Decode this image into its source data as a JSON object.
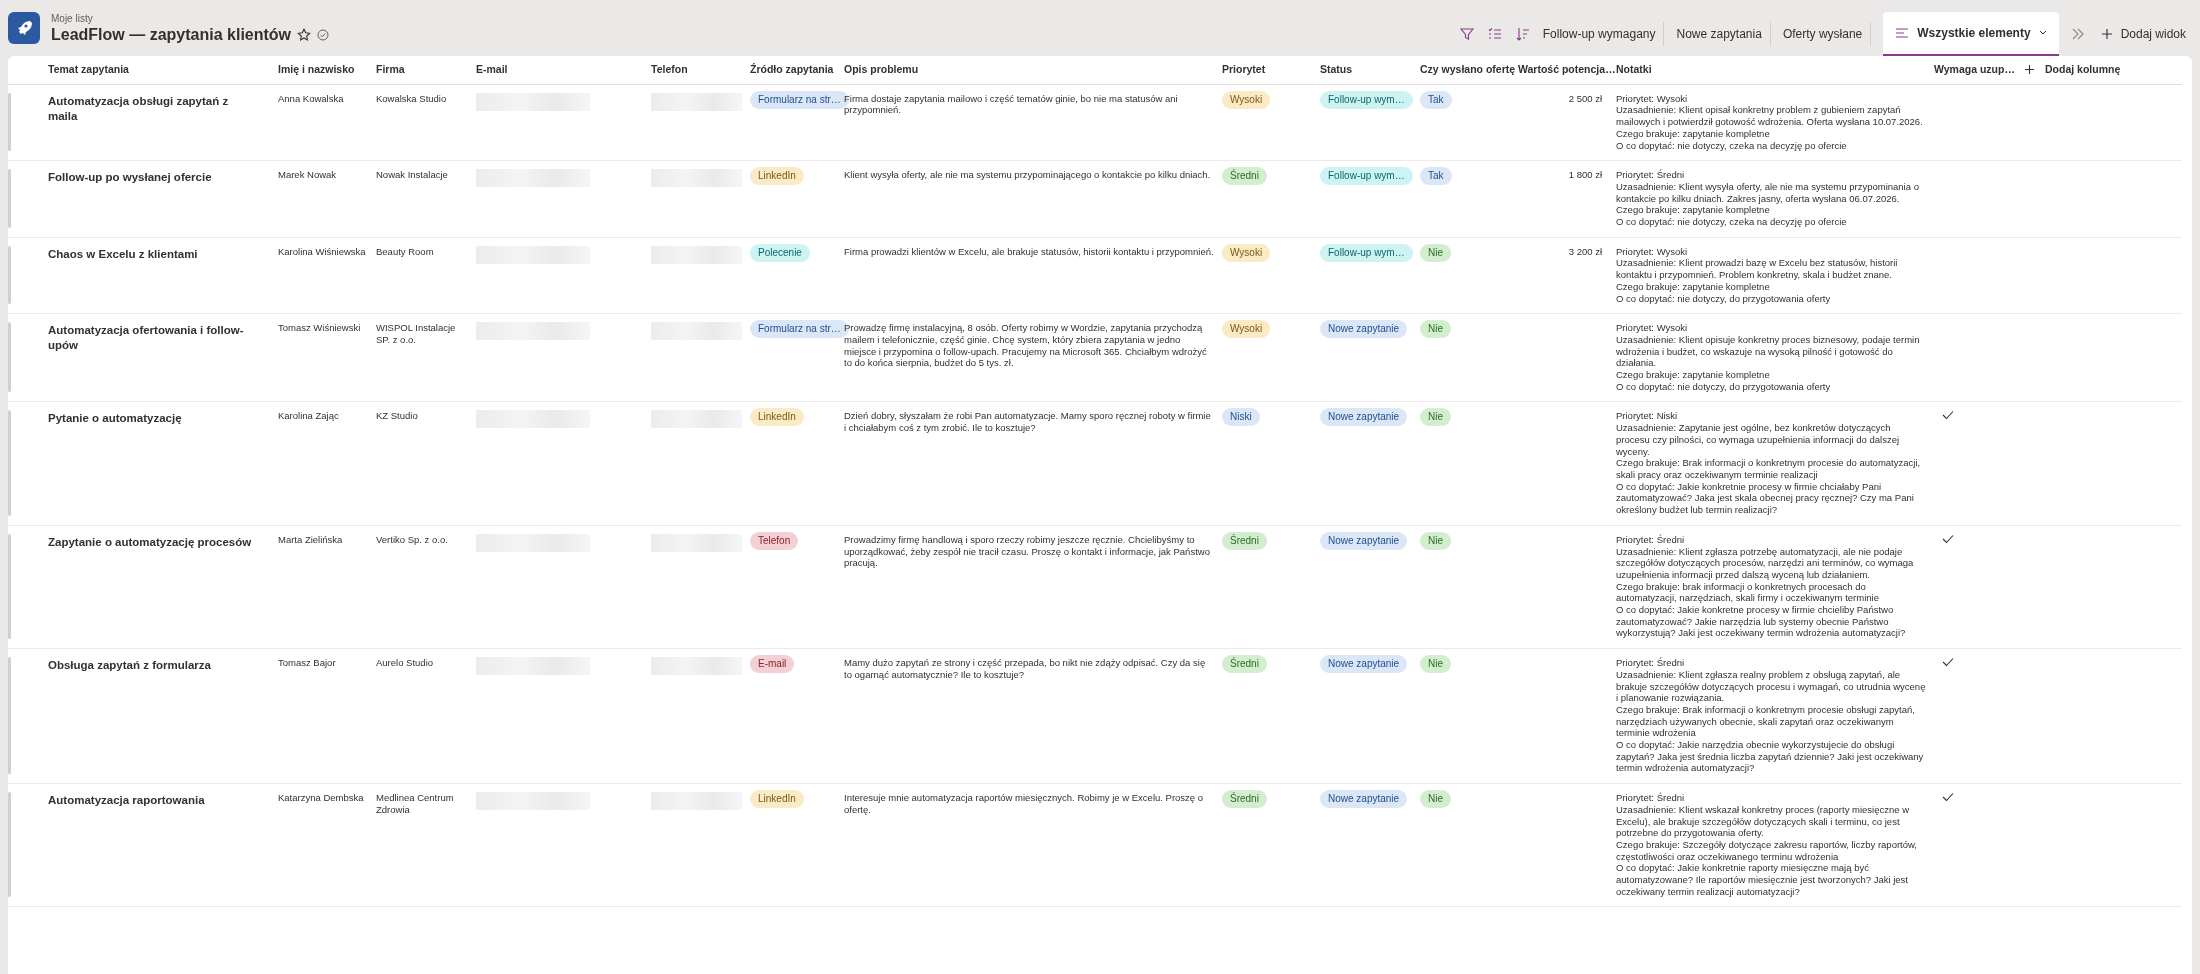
{
  "header": {
    "breadcrumb": "Moje listy",
    "title": "LeadFlow — zapytania klientów",
    "favorite": false
  },
  "views": [
    {
      "label": "Follow-up wymagany",
      "selected": false
    },
    {
      "label": "Nowe zapytania",
      "selected": false
    },
    {
      "label": "Oferty wysłane",
      "selected": false
    },
    {
      "label": "Wszystkie elementy",
      "selected": true
    }
  ],
  "add_view": "Dodaj widok",
  "columns": [
    "Temat zapytania",
    "Imię i nazwisko",
    "Firma",
    "E-mail",
    "Telefon",
    "Źródło zapytania",
    "Opis problemu",
    "Priorytet",
    "Status",
    "Czy wysłano ofertę",
    "Wartość potencja…",
    "Notatki",
    "Wymaga uzup…"
  ],
  "add_column": "Dodaj kolumnę",
  "rows": [
    {
      "subject": "Automatyzacja obsługi zapytań z maila",
      "name": "Anna Kowalska",
      "company": "Kowalska Studio",
      "source": {
        "label": "Formularz na str…",
        "color": "#dbe7f6"
      },
      "description": "Firma dostaje zapytania mailowo i część tematów ginie, bo nie ma statusów ani przypomnień.",
      "priority": {
        "label": "Wysoki",
        "color": "#fbeac6"
      },
      "status": {
        "label": "Follow-up wym…",
        "color": "#cdf3f3"
      },
      "offer_sent": {
        "label": "Tak",
        "color": "#dbe7f6"
      },
      "value": "2 500 zł",
      "notes": [
        "Priorytet: Wysoki",
        "Uzasadnienie: Klient opisał konkretny problem z gubieniem zapytań mailowych i potwierdził gotowość wdrożenia. Oferta wysłana 10.07.2026.",
        "Czego brakuje: zapytanie kompletne",
        "O co dopytać: nie dotyczy, czeka na decyzję po ofercie"
      ],
      "needs_completion": false
    },
    {
      "subject": "Follow-up po wysłanej ofercie",
      "name": "Marek Nowak",
      "company": "Nowak Instalacje",
      "source": {
        "label": "LinkedIn",
        "color": "#fbeac6"
      },
      "description": "Klient wysyła oferty, ale nie ma systemu przypominającego o kontakcie po kilku dniach.",
      "priority": {
        "label": "Średni",
        "color": "#d3eecf"
      },
      "status": {
        "label": "Follow-up wym…",
        "color": "#cdf3f3"
      },
      "offer_sent": {
        "label": "Tak",
        "color": "#dbe7f6"
      },
      "value": "1 800 zł",
      "notes": [
        "Priorytet: Średni",
        "Uzasadnienie: Klient wysyła oferty, ale nie ma systemu przypominania o kontakcie po kilku dniach. Zakres jasny, oferta wysłana 06.07.2026.",
        "Czego brakuje: zapytanie kompletne",
        "O co dopytać: nie dotyczy, czeka na decyzję po ofercie"
      ],
      "needs_completion": false
    },
    {
      "subject": "Chaos w Excelu z klientami",
      "name": "Karolina Wiśniewska",
      "company": "Beauty Room",
      "source": {
        "label": "Polecenie",
        "color": "#cdf3f3"
      },
      "description": "Firma prowadzi klientów w Excelu, ale brakuje statusów, historii kontaktu i przypomnień.",
      "priority": {
        "label": "Wysoki",
        "color": "#fbeac6"
      },
      "status": {
        "label": "Follow-up wym…",
        "color": "#cdf3f3"
      },
      "offer_sent": {
        "label": "Nie",
        "color": "#d3eecf"
      },
      "value": "3 200 zł",
      "notes": [
        "Priorytet: Wysoki",
        "Uzasadnienie: Klient prowadzi bazę w Excelu bez statusów, historii kontaktu i przypomnień. Problem konkretny, skala i budżet znane.",
        "Czego brakuje: zapytanie kompletne",
        "O co dopytać: nie dotyczy, do przygotowania oferty"
      ],
      "needs_completion": false
    },
    {
      "subject": "Automatyzacja ofertowania i follow-upów",
      "name": "Tomasz Wiśniewski",
      "company": "WISPOL Instalacje SP. z o.o.",
      "source": {
        "label": "Formularz na str…",
        "color": "#dbe7f6"
      },
      "description": "Prowadzę firmę instalacyjną, 8 osób. Oferty robimy w Wordzie, zapytania przychodzą mailem i telefonicznie, część ginie. Chcę system, który zbiera zapytania w jedno miejsce i przypomina o follow-upach. Pracujemy na Microsoft 365. Chciałbym wdrożyć to do końca sierpnia, budżet do 5 tys. zł.",
      "priority": {
        "label": "Wysoki",
        "color": "#fbeac6"
      },
      "status": {
        "label": "Nowe zapytanie",
        "color": "#dbe7f6"
      },
      "offer_sent": {
        "label": "Nie",
        "color": "#d3eecf"
      },
      "notes": [
        "Priorytet: Wysoki",
        "Uzasadnienie: Klient opisuje konkretny proces biznesowy, podaje termin wdrożenia i budżet, co wskazuje na wysoką pilność i gotowość do działania.",
        "Czego brakuje: zapytanie kompletne",
        "O co dopytać: nie dotyczy, do przygotowania oferty"
      ],
      "needs_completion": false
    },
    {
      "subject": "Pytanie o automatyzację",
      "name": "Karolina Zając",
      "company": "KZ Studio",
      "source": {
        "label": "LinkedIn",
        "color": "#fbeac6"
      },
      "description": "Dzień dobry, słyszałam że robi Pan automatyzacje. Mamy sporo ręcznej roboty w firmie i chciałabym coś z tym zrobić. Ile to kosztuje?",
      "priority": {
        "label": "Niski",
        "color": "#dbe7f6"
      },
      "status": {
        "label": "Nowe zapytanie",
        "color": "#dbe7f6"
      },
      "offer_sent": {
        "label": "Nie",
        "color": "#d3eecf"
      },
      "notes": [
        "Priorytet: Niski",
        "Uzasadnienie: Zapytanie jest ogólne, bez konkretów dotyczących procesu czy pilności, co wymaga uzupełnienia informacji do dalszej wyceny.",
        "Czego brakuje: Brak informacji o konkretnym procesie do automatyzacji, skali pracy oraz oczekiwanym terminie realizacji",
        "O co dopytać: Jakie konkretnie procesy w firmie chciałaby Pani zautomatyzować? Jaka jest skala obecnej pracy ręcznej? Czy ma Pani określony budżet lub termin realizacji?"
      ],
      "needs_completion": true
    },
    {
      "subject": "Zapytanie o automatyzację procesów",
      "name": "Marta Zielińska",
      "company": "Vertiko Sp. z o.o.",
      "source": {
        "label": "Telefon",
        "color": "#f3d0d3"
      },
      "description": "Prowadzimy firmę handlową i sporo rzeczy robimy jeszcze ręcznie. Chcielibyśmy to uporządkować, żeby zespół nie tracił czasu. Proszę o kontakt i informacje, jak Państwo pracują.",
      "priority": {
        "label": "Średni",
        "color": "#d3eecf"
      },
      "status": {
        "label": "Nowe zapytanie",
        "color": "#dbe7f6"
      },
      "offer_sent": {
        "label": "Nie",
        "color": "#d3eecf"
      },
      "notes": [
        "Priorytet: Średni",
        "Uzasadnienie: Klient zgłasza potrzebę automatyzacji, ale nie podaje szczegółów dotyczących procesów, narzędzi ani terminów, co wymaga uzupełnienia informacji przed dalszą wyceną lub działaniem.",
        "Czego brakuje: brak informacji o konkretnych procesach do automatyzacji, narzędziach, skali firmy i oczekiwanym terminie",
        "O co dopytać: Jakie konkretne procesy w firmie chcieliby Państwo zautomatyzować? Jakie narzędzia lub systemy obecnie Państwo wykorzystują? Jaki jest oczekiwany termin wdrożenia automatyzacji?"
      ],
      "needs_completion": true
    },
    {
      "subject": "Obsługa zapytań z formularza",
      "name": "Tomasz Bajor",
      "company": "Aurelo Studio",
      "source": {
        "label": "E-mail",
        "color": "#f3d0d3"
      },
      "description": "Mamy dużo zapytań ze strony i część przepada, bo nikt nie zdąży odpisać. Czy da się to ogarnąć automatycznie? Ile to kosztuje?",
      "priority": {
        "label": "Średni",
        "color": "#d3eecf"
      },
      "status": {
        "label": "Nowe zapytanie",
        "color": "#dbe7f6"
      },
      "offer_sent": {
        "label": "Nie",
        "color": "#d3eecf"
      },
      "notes": [
        "Priorytet: Średni",
        "Uzasadnienie: Klient zgłasza realny problem z obsługą zapytań, ale brakuje szczegółów dotyczących procesu i wymagań, co utrudnia wycenę i planowanie rozwiązania.",
        "Czego brakuje: Brak informacji o konkretnym procesie obsługi zapytań, narzędziach używanych obecnie, skali zapytań oraz oczekiwanym terminie wdrożenia",
        "O co dopytać: Jakie narzędzia obecnie wykorzystujecie do obsługi zapytań? Jaka jest średnia liczba zapytań dziennie? Jaki jest oczekiwany termin wdrożenia automatyzacji?"
      ],
      "needs_completion": true
    },
    {
      "subject": "Automatyzacja raportowania",
      "name": "Katarzyna Dembska",
      "company": "Medlinea Centrum Zdrowia",
      "source": {
        "label": "LinkedIn",
        "color": "#fbeac6"
      },
      "description": "Interesuje mnie automatyzacja raportów miesięcznych. Robimy je w Excelu. Proszę o ofertę.",
      "priority": {
        "label": "Średni",
        "color": "#d3eecf"
      },
      "status": {
        "label": "Nowe zapytanie",
        "color": "#dbe7f6"
      },
      "offer_sent": {
        "label": "Nie",
        "color": "#d3eecf"
      },
      "notes": [
        "Priorytet: Średni",
        "Uzasadnienie: Klient wskazał konkretny proces (raporty miesięczne w Excelu), ale brakuje szczegółów dotyczących skali i terminu, co jest potrzebne do przygotowania oferty.",
        "Czego brakuje: Szczegóły dotyczące zakresu raportów, liczby raportów, częstotliwości oraz oczekiwanego terminu wdrożenia",
        "O co dopytać: Jakie konkretnie raporty miesięczne mają być automatyzowane? Ile raportów miesięcznie jest tworzonych? Jaki jest oczekiwany termin realizacji automatyzacji?"
      ],
      "needs_completion": true
    }
  ]
}
